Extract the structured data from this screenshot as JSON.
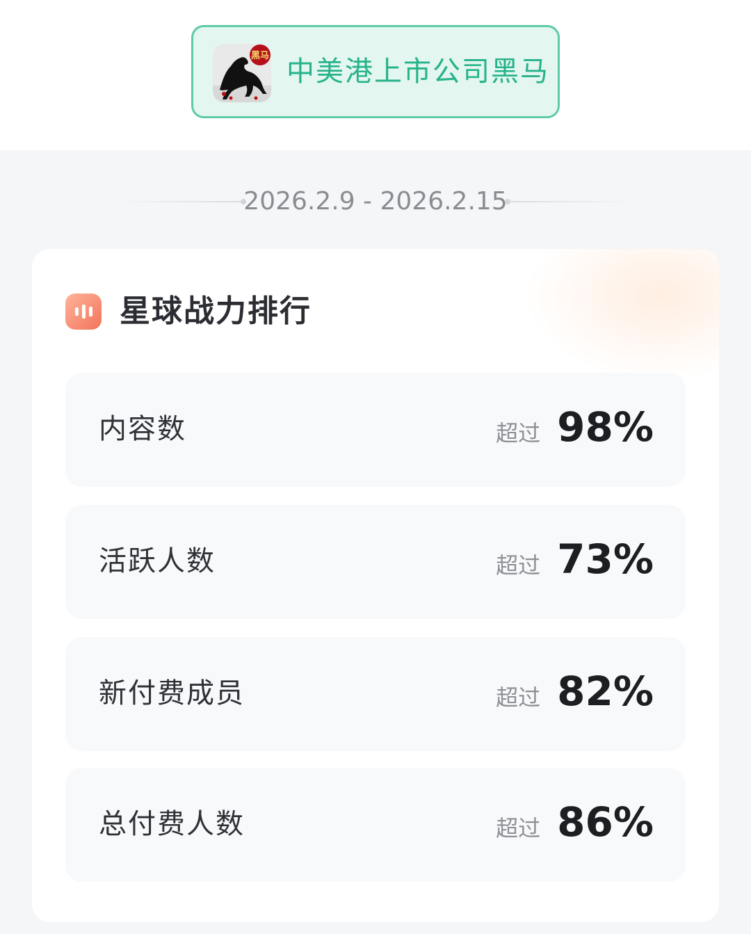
{
  "group": {
    "avatar_text": "黑马",
    "name": "中美港上市公司黑马"
  },
  "date_range": "2026.2.9 - 2026.2.15",
  "card": {
    "icon": "bar-chart-icon",
    "title": "星球战力排行"
  },
  "stats": [
    {
      "label": "内容数",
      "prefix": "超过",
      "value": "98%"
    },
    {
      "label": "活跃人数",
      "prefix": "超过",
      "value": "73%"
    },
    {
      "label": "新付费成员",
      "prefix": "超过",
      "value": "82%"
    },
    {
      "label": "总付费人数",
      "prefix": "超过",
      "value": "86%"
    }
  ],
  "colors": {
    "accent_green": "#26b38a",
    "badge_bg": "#e3f6f0",
    "icon_gradient_start": "#ffb49a",
    "icon_gradient_end": "#f2745a"
  }
}
